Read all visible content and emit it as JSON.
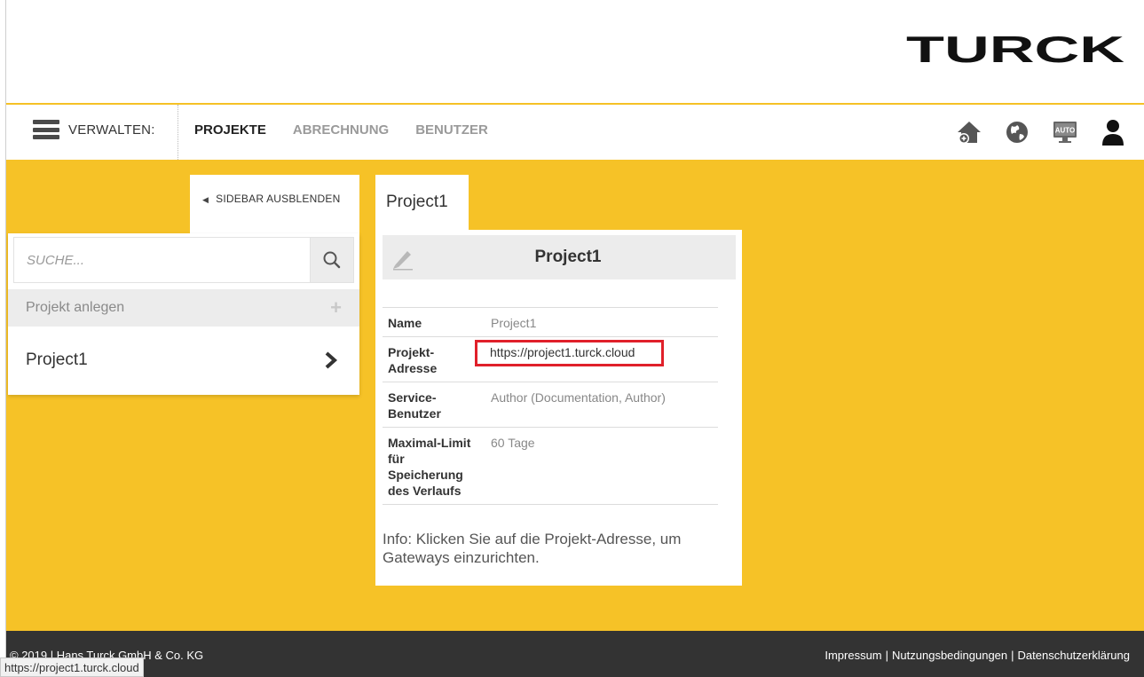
{
  "brand": {
    "logo_text": "TURCK",
    "accent_color": "#f6c227"
  },
  "nav": {
    "menu_label": "VERWALTEN:",
    "tabs": [
      {
        "label": "PROJEKTE",
        "active": true
      },
      {
        "label": "ABRECHNUNG",
        "active": false
      },
      {
        "label": "BENUTZER",
        "active": false
      }
    ],
    "icons": [
      "home-add-icon",
      "globe-icon",
      "auto-monitor-icon",
      "user-icon"
    ]
  },
  "sidebar": {
    "toggle_label": "SIDEBAR AUSBLENDEN",
    "search_placeholder": "SUCHE...",
    "add_label": "Projekt anlegen",
    "projects": [
      {
        "label": "Project1"
      }
    ]
  },
  "detail": {
    "tab_label": "Project1",
    "title": "Project1",
    "rows": [
      {
        "key": "Name",
        "value": "Project1"
      },
      {
        "key": "Projekt-Adresse",
        "value": "https://project1.turck.cloud",
        "highlighted": true
      },
      {
        "key": "Service-Benutzer",
        "value": "Author (Documentation, Author)"
      },
      {
        "key": "Maximal-Limit für Speicherung des Verlaufs",
        "value": "60 Tage"
      }
    ],
    "note": "Info: Klicken Sie auf die Projekt-Adresse, um Gateways einzurichten."
  },
  "footer": {
    "copyright": "© 2019 | Hans Turck GmbH & Co. KG",
    "links": [
      "Impressum",
      "Nutzungsbedingungen",
      "Datenschutzerklärung"
    ]
  },
  "status_tooltip": "https://project1.turck.cloud"
}
